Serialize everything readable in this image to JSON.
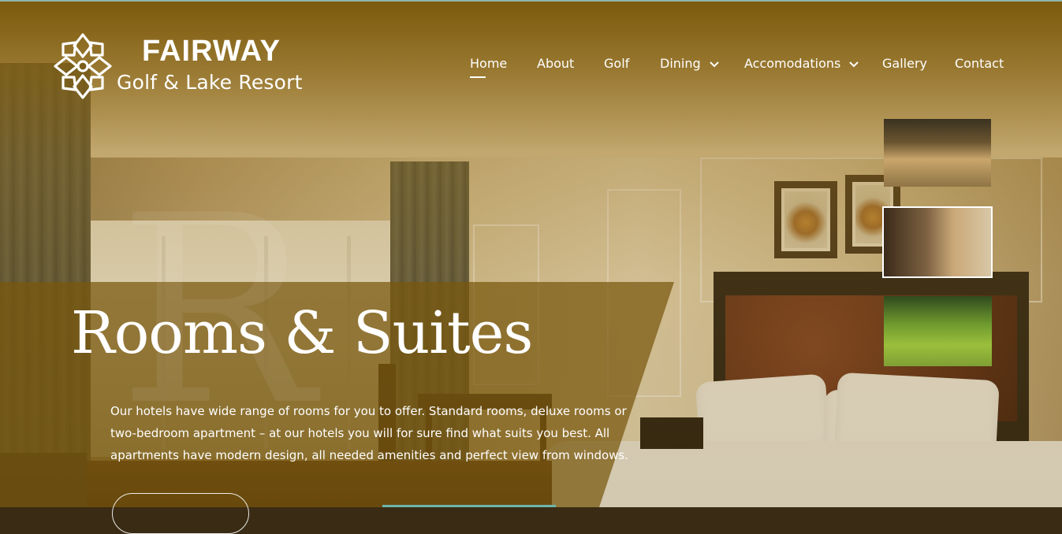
{
  "brand": {
    "name": "FAIRWAY",
    "subtitle": "Golf & Lake Resort"
  },
  "nav": {
    "items": [
      {
        "label": "Home",
        "active": true
      },
      {
        "label": "About"
      },
      {
        "label": "Golf"
      },
      {
        "label": "Dining",
        "has_dropdown": true
      },
      {
        "label": "Accomodations",
        "has_dropdown": true
      },
      {
        "label": "Gallery"
      },
      {
        "label": "Contact"
      }
    ]
  },
  "hero": {
    "title": "Rooms & Suites",
    "watermark": "R",
    "description": "Our hotels have wide range of rooms for you to offer. Standard rooms, deluxe rooms or two-bedroom apartment – at our hotels you will for sure find what suits you best. All apartments have modern design, all needed amenities and perfect view from windows.",
    "thumbnails": [
      {
        "name": "dining-hall",
        "active": false
      },
      {
        "name": "hotel-room",
        "active": true
      },
      {
        "name": "golf-course-aerial",
        "active": false
      }
    ]
  },
  "colors": {
    "overlay": "#7a5808",
    "text": "#ffffff",
    "accent": "#6fb3ac"
  }
}
